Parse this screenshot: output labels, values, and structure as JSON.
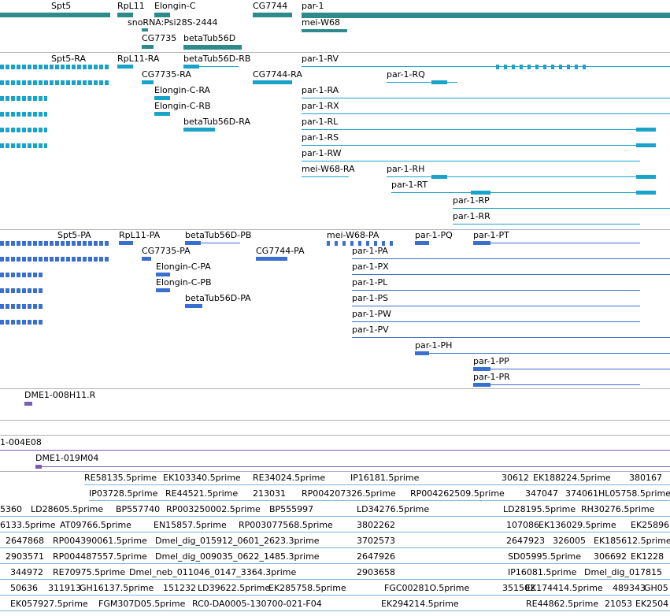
{
  "colors": {
    "gene": "#2e8b8b",
    "transcript": "#1aa3c8",
    "polypeptide": "#3a6fd0",
    "bac": "#7a5cb0",
    "est": "#7fb3d9",
    "separator": "#b0b0c0"
  },
  "tracks": {
    "genes": {
      "labels": [
        "Spt5",
        "RpL11",
        "Elongin-C",
        "snoRNA:Psi28S-2444",
        "CG7735",
        "betaTub56D",
        "CG7744",
        "par-1",
        "mei-W68"
      ]
    },
    "transcripts": {
      "labels": [
        "Spt5-RA",
        "RpL11-RA",
        "betaTub56D-RB",
        "par-1-RV",
        "CG7735-RA",
        "CG7744-RA",
        "par-1-RQ",
        "Elongin-C-RA",
        "par-1-RA",
        "Elongin-C-RB",
        "par-1-RX",
        "betaTub56D-RA",
        "par-1-RL",
        "par-1-RS",
        "par-1-RW",
        "mei-W68-RA",
        "par-1-RH",
        "par-1-RT",
        "par-1-RP",
        "par-1-RR"
      ]
    },
    "polypeptides": {
      "labels": [
        "Spt5-PA",
        "RpL11-PA",
        "betaTub56D-PB",
        "mei-W68-PA",
        "par-1-PQ",
        "par-1-PT",
        "CG7735-PA",
        "CG7744-PA",
        "par-1-PA",
        "Elongin-C-PA",
        "par-1-PX",
        "Elongin-C-PB",
        "par-1-PL",
        "betaTub56D-PA",
        "par-1-PS",
        "par-1-PW",
        "par-1-PV",
        "par-1-PH",
        "par-1-PP",
        "par-1-PR"
      ]
    },
    "bac1": {
      "labels": [
        "DME1-008H11.R"
      ]
    },
    "bac2": {
      "labels": [
        "1-004E08",
        "DME1-019M04"
      ]
    },
    "ests": {
      "labels": [
        "RE58135.5prime",
        "EK103340.5prime",
        "RE34024.5prime",
        "IP16181.5prime",
        "30612",
        "EK188224.5prime",
        "380167",
        "IP03728.5prime",
        "RE44521.5prime",
        "213031",
        "RP004207326.5prime",
        "RP004262509.5prime",
        "347047",
        "374061",
        "HL05758.5prime",
        "5360",
        "LD28605.5prime",
        "BP557740",
        "RP003250002.5prime",
        "BP555997",
        "LD34276.5prime",
        "LD28195.5prime",
        "RH30276.5prime",
        "6133.5prime",
        "AT09766.5prime",
        "EN15857.5prime",
        "RP003077568.5prime",
        "3802262",
        "107086",
        "EK136029.5prime",
        "EK25896",
        "2647868",
        "RP004390061.5prime",
        "Dmel_dig_015912_0601_2623.3prime",
        "3702573",
        "2647923",
        "326005",
        "EK185612.5prime",
        "2903571",
        "RP004487557.5prime",
        "Dmel_dig_009035_0622_1485.3prime",
        "2647926",
        "SD05995.5prime",
        "306692",
        "EK1228",
        "344972",
        "RE70975.5prime",
        "Dmel_neb_011046_0147_3364.3prime",
        "2903658",
        "IP16081.5prime",
        "Dmel_dig_017815",
        "50636",
        "311913",
        "GH16137.5prime",
        "151232",
        "LD39622.5prime",
        "EK285758.5prime",
        "FGC00281O.5prime",
        "351502",
        "EK174414.5prime",
        "489343",
        "GH05",
        "EK057927.5prime",
        "FGM307D05.5prime",
        "RC0-DA0005-130700-021-F04",
        "EK294214.5prime",
        "RE44862.5prime",
        "21053",
        "EK2504"
      ]
    }
  }
}
